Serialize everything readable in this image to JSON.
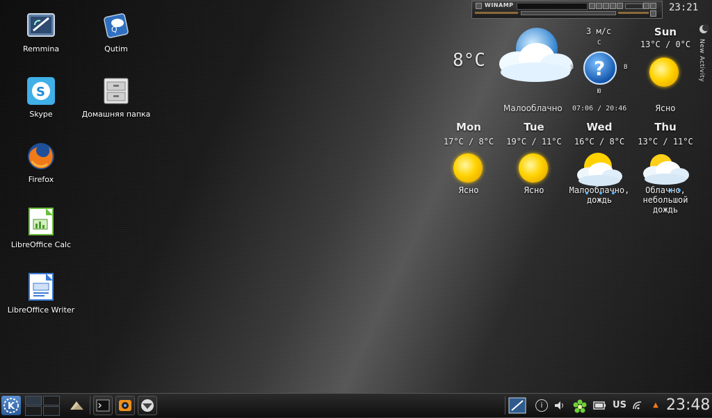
{
  "desktop": {
    "icons": [
      {
        "label": "Remmina",
        "icon": "remmina-icon"
      },
      {
        "label": "Qutim",
        "icon": "qutim-icon"
      },
      {
        "label": "Skype",
        "icon": "skype-icon"
      },
      {
        "label": "Домашняя папка",
        "icon": "home-folder-icon"
      },
      {
        "label": "Firefox",
        "icon": "firefox-icon"
      },
      {
        "label": "LibreOffice Calc",
        "icon": "libreoffice-calc-icon"
      },
      {
        "label": "LibreOffice Writer",
        "icon": "libreoffice-writer-icon"
      }
    ]
  },
  "winamp": {
    "title": "WINAMP"
  },
  "top_clock": "23:21",
  "new_activity": "New Activity",
  "weather": {
    "current_temp": "8°C",
    "wind": "3 м/с",
    "compass": {
      "n": "С",
      "s": "Ю",
      "e": "В",
      "w": "З"
    },
    "current_condition": "Малооблачно",
    "sunrise_sunset": "07:06 / 20:46",
    "today": {
      "name": "Sun",
      "temps": "13°C / 0°C",
      "condition": "Ясно"
    },
    "forecast": [
      {
        "name": "Mon",
        "temps": "17°C / 8°C",
        "condition": "Ясно",
        "icon": "sun-icon"
      },
      {
        "name": "Tue",
        "temps": "19°C / 11°C",
        "condition": "Ясно",
        "icon": "sun-icon"
      },
      {
        "name": "Wed",
        "temps": "16°C / 8°C",
        "condition": "Малооблачно, дождь",
        "icon": "sun-cloud-rain-icon"
      },
      {
        "name": "Thu",
        "temps": "13°C / 11°C",
        "condition": "Облачно, небольшой дождь",
        "icon": "cloud-rain-icon"
      }
    ]
  },
  "taskbar": {
    "keyboard_layout": "US",
    "clock": "23:48"
  },
  "colors": {
    "accent": "#3b82c4",
    "sun": "#ffd200",
    "text": "#e6e6e6"
  }
}
